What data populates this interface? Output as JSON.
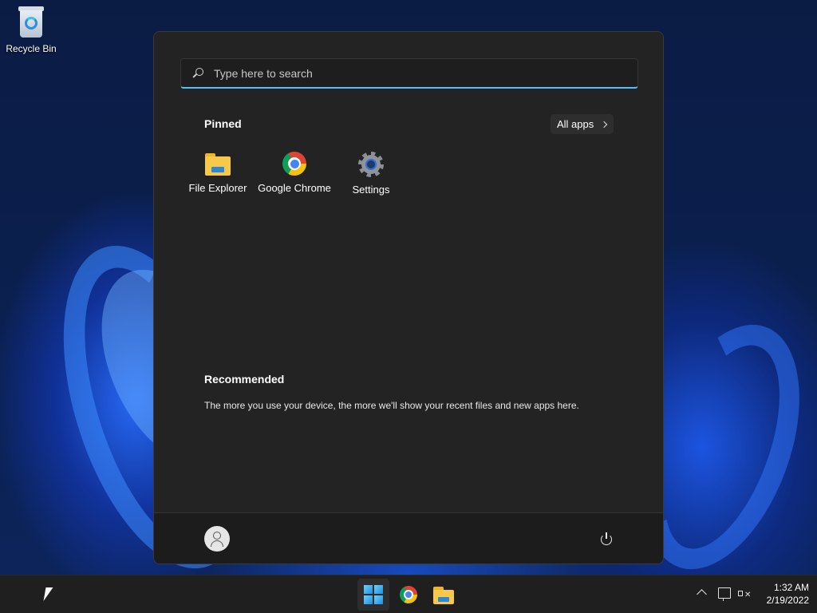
{
  "desktop": {
    "icons": [
      {
        "label": "Recycle Bin",
        "icon": "recycle-bin-icon"
      }
    ]
  },
  "start_menu": {
    "search": {
      "placeholder": "Type here to search"
    },
    "pinned": {
      "title": "Pinned",
      "all_apps_label": "All apps",
      "apps": [
        {
          "label": "File Explorer",
          "icon": "file-explorer-icon"
        },
        {
          "label": "Google Chrome",
          "icon": "chrome-icon"
        },
        {
          "label": "Settings",
          "icon": "settings-gear-icon"
        }
      ]
    },
    "recommended": {
      "title": "Recommended",
      "empty_text": "The more you use your device, the more we'll show your recent files and new apps here."
    },
    "footer": {
      "user_name": "",
      "avatar_icon": "user-avatar-icon",
      "power_icon": "power-icon"
    }
  },
  "taskbar": {
    "apps": [
      {
        "name": "Start",
        "icon": "windows-start-icon",
        "active": true
      },
      {
        "name": "Google Chrome",
        "icon": "chrome-icon"
      },
      {
        "name": "File Explorer",
        "icon": "file-explorer-icon"
      }
    ],
    "tray": {
      "overflow_icon": "chevron-up-icon",
      "network_icon": "network-icon",
      "volume_icon": "volume-muted-icon",
      "time": "1:32 AM",
      "date": "2/19/2022"
    }
  },
  "colors": {
    "accent": "#4cc2ff",
    "menu_bg": "#232323",
    "taskbar_bg": "#1f1f1f"
  }
}
